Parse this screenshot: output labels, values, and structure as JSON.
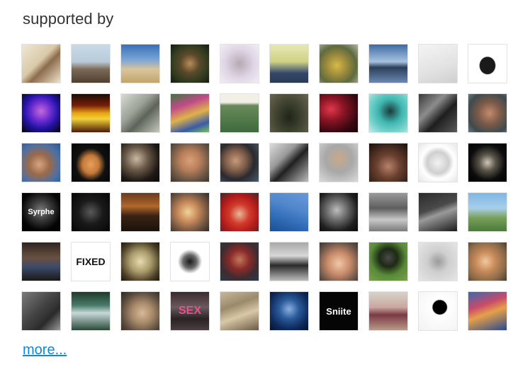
{
  "section": {
    "title": "supported by",
    "more_label": "more..."
  },
  "supporters": [
    {
      "caption": "",
      "style": "linear-gradient(135deg,#efe7d6 0%,#d9c9a7 45%,#8c6b4c 60%,#efe3cf 100%)"
    },
    {
      "caption": "",
      "style": "linear-gradient(180deg,#c9dbe8 0%,#b9cad8 45%,#7c6a57 65%,#4e4030 100%)"
    },
    {
      "caption": "",
      "style": "linear-gradient(180deg,#3b6fb6 0%,#7aa5d6 40%,#d9c59a 65%,#c4a46c 100%)"
    },
    {
      "caption": "",
      "style": "radial-gradient(circle at 50% 50%,#b98c56 0%,#5b4a2b 35%,#2e3a1e 70%,#151a10 100%)"
    },
    {
      "caption": "",
      "style": "radial-gradient(ellipse at 50% 50%,#b6a9b3 0%,#e0d6e6 55%,#f3eef5 100%)"
    },
    {
      "caption": "",
      "style": "linear-gradient(180deg,#e6e8b4 0%,#cfd185 45%,#33486a 75%,#2a3a55 100%)"
    },
    {
      "caption": "",
      "style": "radial-gradient(circle at 45% 55%,#d9b94a 0%,#9b8a3c 35%,#5e6a3f 65%,#b3b6a3 100%)"
    },
    {
      "caption": "",
      "style": "linear-gradient(180deg,#3e6aa3 0%,#a8c3de 45%,#2b3f5a 60%,#6a88b0 100%)"
    },
    {
      "caption": "",
      "style": "linear-gradient(160deg,#f4f4f4 0%,#e2e2e2 60%,#cfcfcf 100%)"
    },
    {
      "caption": "",
      "style": "radial-gradient(ellipse at 50% 55%,#1a1a1a 0%,#1a1a1a 28%,#ffffff 31%,#ffffff 100%)"
    },
    {
      "caption": "",
      "style": "radial-gradient(circle at 50% 45%,#c56bd9 0%,#6b2bd1 35%,#2414a6 60%,#050308 100%)"
    },
    {
      "caption": "",
      "style": "linear-gradient(180deg,#1a0d05 0%,#7a1d0a 30%,#e8a414 50%,#f2d23a 65%,#4a1a08 100%)"
    },
    {
      "caption": "",
      "style": "linear-gradient(135deg,#d8dcd3 0%,#9aa095 40%,#5d6358 60%,#c5c9be 100%)"
    },
    {
      "caption": "",
      "style": "linear-gradient(160deg,#3a7a3a 0%,#c04a8a 30%,#e0b24a 55%,#3a5aa8 80%,#7ac05a 100%)"
    },
    {
      "caption": "",
      "style": "linear-gradient(180deg,#f2efe6 0%,#f2efe6 22%,#6a8a5a 30%,#3d6a3d 100%)"
    },
    {
      "caption": "",
      "style": "radial-gradient(ellipse at 50% 60%,#1f2418 0%,#3a3e2c 40%,#6a6650 100%)"
    },
    {
      "caption": "",
      "style": "radial-gradient(ellipse at 30% 40%,#e0384a 0%,#8a1424 35%,#3a0812 70%,#150305 100%)"
    },
    {
      "caption": "",
      "style": "radial-gradient(circle at 55% 45%,#1a3a3a 0%,#3fb6b0 40%,#7fd6d0 75%,#c9ece9 100%)"
    },
    {
      "caption": "",
      "style": "linear-gradient(135deg,#3a3a3a 0%,#8c8c8c 35%,#1e1e1e 60%,#5a5a5a 100%)"
    },
    {
      "caption": "",
      "style": "radial-gradient(circle at 55% 50%,#c68a6c 0%,#7a5a48 40%,#3e4a4e 75%,#6a7a7e 100%)"
    },
    {
      "caption": "",
      "style": "radial-gradient(circle at 45% 55%,#d7a481 0%,#9a6a4a 35%,#4a6fa8 70%,#2e5690 100%)"
    },
    {
      "caption": "",
      "style": "radial-gradient(ellipse at 50% 55%,#e8a05a 0%,#c57a3a 30%,#101010 55%,#050505 100%)"
    },
    {
      "caption": "",
      "style": "radial-gradient(circle at 40% 40%,#c9b9a4 0%,#6a5a48 35%,#1e1814 70%,#0a0806 100%)"
    },
    {
      "caption": "",
      "style": "radial-gradient(circle at 50% 45%,#d9a07a 0%,#b87f5a 35%,#6a5644 70%,#3e342a 100%)"
    },
    {
      "caption": "",
      "style": "radial-gradient(circle at 40% 45%,#c89a7a 0%,#7a5a48 35%,#2a2a2e 60%,#4a5a6e 100%)"
    },
    {
      "caption": "",
      "style": "linear-gradient(135deg,#dcdcdc 0%,#9a9a9a 35%,#202020 55%,#bdbdbd 100%)"
    },
    {
      "caption": "",
      "style": "radial-gradient(circle at 50% 40%,#c9a88a 0%,#a8a8a8 45%,#dadada 100%)"
    },
    {
      "caption": "",
      "style": "radial-gradient(circle at 50% 60%,#b8826a 0%,#6a4030 40%,#1a0f0a 100%)"
    },
    {
      "caption": "",
      "style": "radial-gradient(circle at 50% 50%,#f2f2f2 0%,#cfcfcf 40%,#ffffff 60%,#e6e6e6 100%)"
    },
    {
      "caption": "",
      "style": "radial-gradient(circle at 50% 50%,#d0c8b8 0%,#5a554a 30%,#0c0c0c 65%,#000000 100%)"
    },
    {
      "caption": "Syrphe",
      "captionColor": "#ffffff",
      "captionSize": "11px",
      "style": "radial-gradient(circle at 50% 45%,#7a7a7a 0%,#3a3a3a 35%,#050505 70%,#000000 100%)"
    },
    {
      "caption": "",
      "style": "radial-gradient(circle at 50% 50%,#5a5a5a 0%,#1a1a1a 45%,#050505 100%)"
    },
    {
      "caption": "",
      "style": "linear-gradient(180deg,#6a3a1e 0%,#b0672a 35%,#3a2214 60%,#1a120a 100%)"
    },
    {
      "caption": "",
      "style": "radial-gradient(circle at 45% 50%,#f2d29a 0%,#c88a5a 35%,#7a5a44 65%,#2e2a26 100%)"
    },
    {
      "caption": "",
      "style": "radial-gradient(circle at 50% 55%,#e8b89a 0%,#d23a2a 35%,#b01a1a 65%,#3a2a2a 100%)"
    },
    {
      "caption": "",
      "style": "linear-gradient(200deg,#6a98d8 0%,#4f86cc 40%,#2f6ab5 70%,#1c4f91 100%)"
    },
    {
      "caption": "",
      "style": "radial-gradient(circle at 45% 45%,#bdbdbd 0%,#6a6a6a 35%,#1e1e1e 70%,#0a0a0a 100%)"
    },
    {
      "caption": "",
      "style": "linear-gradient(180deg,#9a9a9a 0%,#5e5e5e 40%,#c8c8c8 70%,#7a7a7a 100%)"
    },
    {
      "caption": "",
      "style": "linear-gradient(160deg,#2a2a2a 0%,#4a4a4a 40%,#9a9a9a 55%,#1a1a1a 100%)"
    },
    {
      "caption": "",
      "style": "linear-gradient(180deg,#7fb6e6 0%,#a8cfe8 40%,#7aa05a 65%,#4a7a3a 100%)"
    },
    {
      "caption": "",
      "style": "linear-gradient(180deg,#2e2620 0%,#6a5040 40%,#3a4a6a 65%,#1a1814 100%)"
    },
    {
      "caption": "FIXED",
      "captionColor": "#111111",
      "captionSize": "14px",
      "style": "linear-gradient(180deg,#ffffff 0%,#ffffff 100%)"
    },
    {
      "caption": "",
      "style": "radial-gradient(ellipse at 50% 50%,#e6dcb0 0%,#a89a6a 40%,#4a3e26 75%,#1e180e 100%)"
    },
    {
      "caption": "",
      "style": "radial-gradient(circle at 50% 50%,#1a1a1a 0%,#6a6a6a 25%,#ffffff 45%,#ffffff 100%)"
    },
    {
      "caption": "",
      "style": "radial-gradient(circle at 50% 45%,#c07a5a 0%,#8a2a2a 35%,#3e2c30 65%,#2a3a4a 100%)"
    },
    {
      "caption": "",
      "style": "linear-gradient(180deg,#a8a8a8 0%,#d8d8d8 35%,#2a2a2a 60%,#bcbcbc 100%)"
    },
    {
      "caption": "",
      "style": "radial-gradient(circle at 50% 55%,#f2c8a8 0%,#c88a6a 40%,#6a5448 75%,#3e3630 100%)"
    },
    {
      "caption": "",
      "style": "radial-gradient(circle at 50% 40%,#4a4a4a 0%,#1e2a14 30%,#5a8a3a 60%,#7aa04a 100%)"
    },
    {
      "caption": "",
      "style": "radial-gradient(circle at 50% 50%,#9a9a9a 0%,#cfcfcf 40%,#e6e6e6 100%)"
    },
    {
      "caption": "",
      "style": "radial-gradient(circle at 45% 50%,#f2c8a0 0%,#c88a5a 35%,#8a6a48 70%,#4a3e30 100%)"
    },
    {
      "caption": "",
      "style": "linear-gradient(135deg,#7a7a7a 0%,#4a4a4a 40%,#2a2a2a 70%,#9a9a9a 100%)"
    },
    {
      "caption": "",
      "style": "linear-gradient(180deg,#1e3a2a 0%,#4a7a6a 35%,#c8d8d8 55%,#2a4a3a 100%)"
    },
    {
      "caption": "",
      "style": "radial-gradient(circle at 55% 55%,#d8b89a 0%,#a88a6a 35%,#5a4a3e 70%,#2e2620 100%)"
    },
    {
      "caption": "SEX",
      "captionColor": "#e6538a",
      "captionSize": "16px",
      "style": "linear-gradient(180deg,#3a2a2e 0%,#6a5a5e 40%,#2a2224 70%,#4a3e40 100%)"
    },
    {
      "caption": "",
      "style": "linear-gradient(160deg,#c8b89a 0%,#9a8a6a 35%,#d8c8a8 60%,#6a5a44 100%)"
    },
    {
      "caption": "",
      "style": "radial-gradient(circle at 50% 45%,#8ab0e0 0%,#2a5a9a 35%,#0e2a5a 70%,#061430 100%)"
    },
    {
      "caption": "Sniite",
      "captionColor": "#ffffff",
      "captionSize": "13px",
      "style": "linear-gradient(180deg,#050505 0%,#050505 100%)"
    },
    {
      "caption": "",
      "style": "linear-gradient(180deg,#d8d2c8 0%,#c8a8a0 40%,#7a3a44 60%,#b89a8a 100%)"
    },
    {
      "caption": "",
      "style": "radial-gradient(circle at 55% 40%,#000000 0%,#000000 22%,#ffffff 25%,#f2f2f2 100%)"
    },
    {
      "caption": "",
      "style": "linear-gradient(160deg,#3a6ab0 0%,#c84a6a 35%,#e6a04a 55%,#2a4a8a 100%)"
    }
  ]
}
